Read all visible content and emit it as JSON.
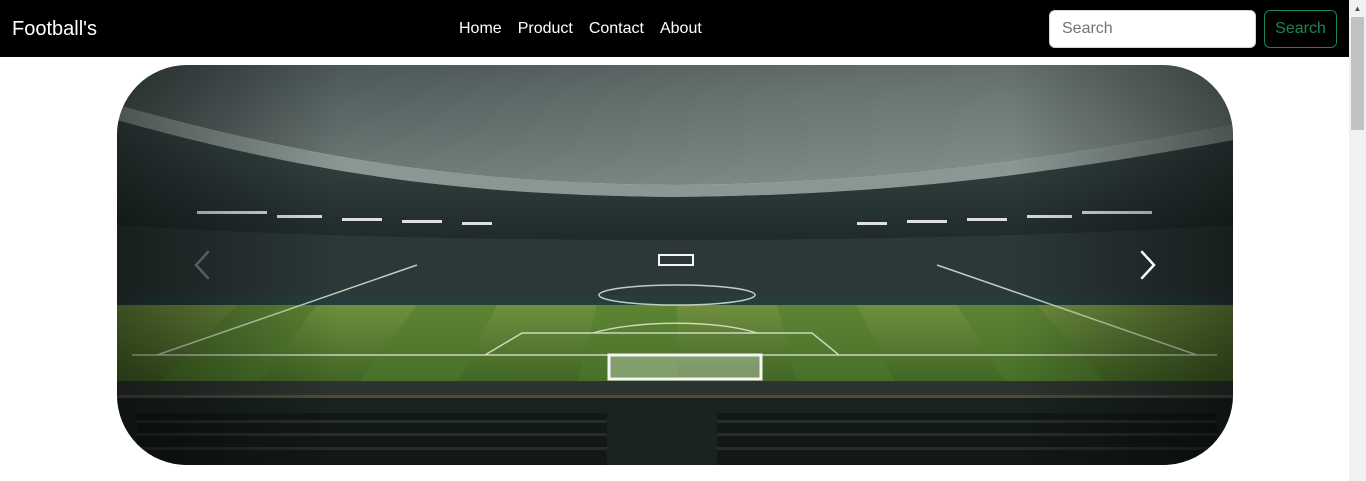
{
  "navbar": {
    "brand": "Football's",
    "links": [
      "Home",
      "Product",
      "Contact",
      "About"
    ],
    "search": {
      "placeholder": "Search",
      "button_label": "Search"
    }
  },
  "carousel": {
    "slide_icon": "stadium-image",
    "controls": {
      "prev_icon": "chevron-left-icon",
      "next_icon": "chevron-right-icon"
    }
  },
  "colors": {
    "navbar_bg": "#000000",
    "accent": "#198754"
  }
}
